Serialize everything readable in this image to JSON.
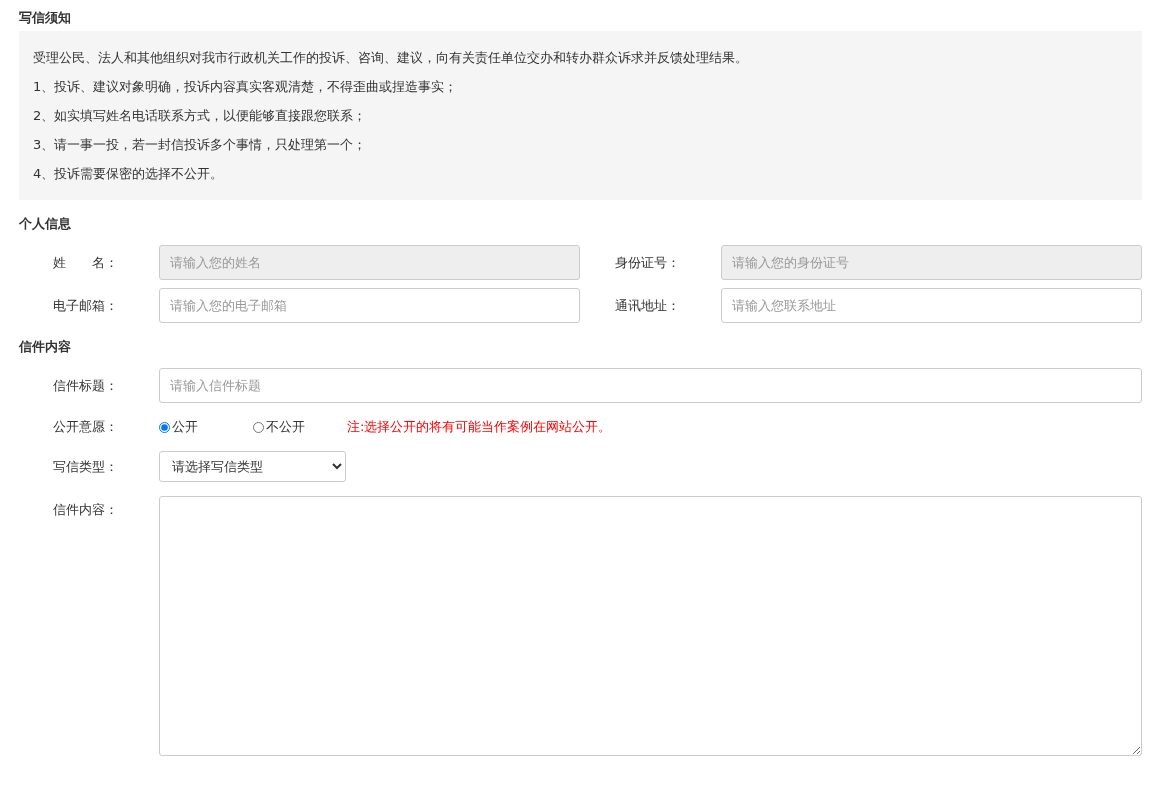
{
  "notice": {
    "title": "写信须知",
    "lines": [
      "受理公民、法人和其他组织对我市行政机关工作的投诉、咨询、建议，向有关责任单位交办和转办群众诉求并反馈处理结果。",
      "1、投诉、建议对象明确，投诉内容真实客观清楚，不得歪曲或捏造事实；",
      "2、如实填写姓名电话联系方式，以便能够直接跟您联系；",
      "3、请一事一投，若一封信投诉多个事情，只处理第一个；",
      "4、投诉需要保密的选择不公开。"
    ]
  },
  "personal": {
    "title": "个人信息",
    "fields": [
      {
        "label": "姓　　名：",
        "placeholder": "请输入您的姓名",
        "disabled": true
      },
      {
        "label": "身份证号：",
        "placeholder": "请输入您的身份证号",
        "disabled": true
      },
      {
        "label": "电子邮箱：",
        "placeholder": "请输入您的电子邮箱",
        "disabled": false
      },
      {
        "label": "通讯地址：",
        "placeholder": "请输入您联系地址",
        "disabled": false
      }
    ]
  },
  "letter": {
    "title": "信件内容",
    "rows": [
      {
        "kind": "input",
        "label": "信件标题：",
        "placeholder": "请输入信件标题"
      },
      {
        "kind": "radio",
        "label": "公开意愿：",
        "options": [
          {
            "label": "公开",
            "selected": true
          },
          {
            "label": "不公开",
            "selected": false
          }
        ],
        "note": "注:选择公开的将有可能当作案例在网站公开。"
      },
      {
        "kind": "select",
        "label": "写信类型：",
        "value": "请选择写信类型"
      },
      {
        "kind": "textarea",
        "label": "信件内容："
      }
    ]
  }
}
